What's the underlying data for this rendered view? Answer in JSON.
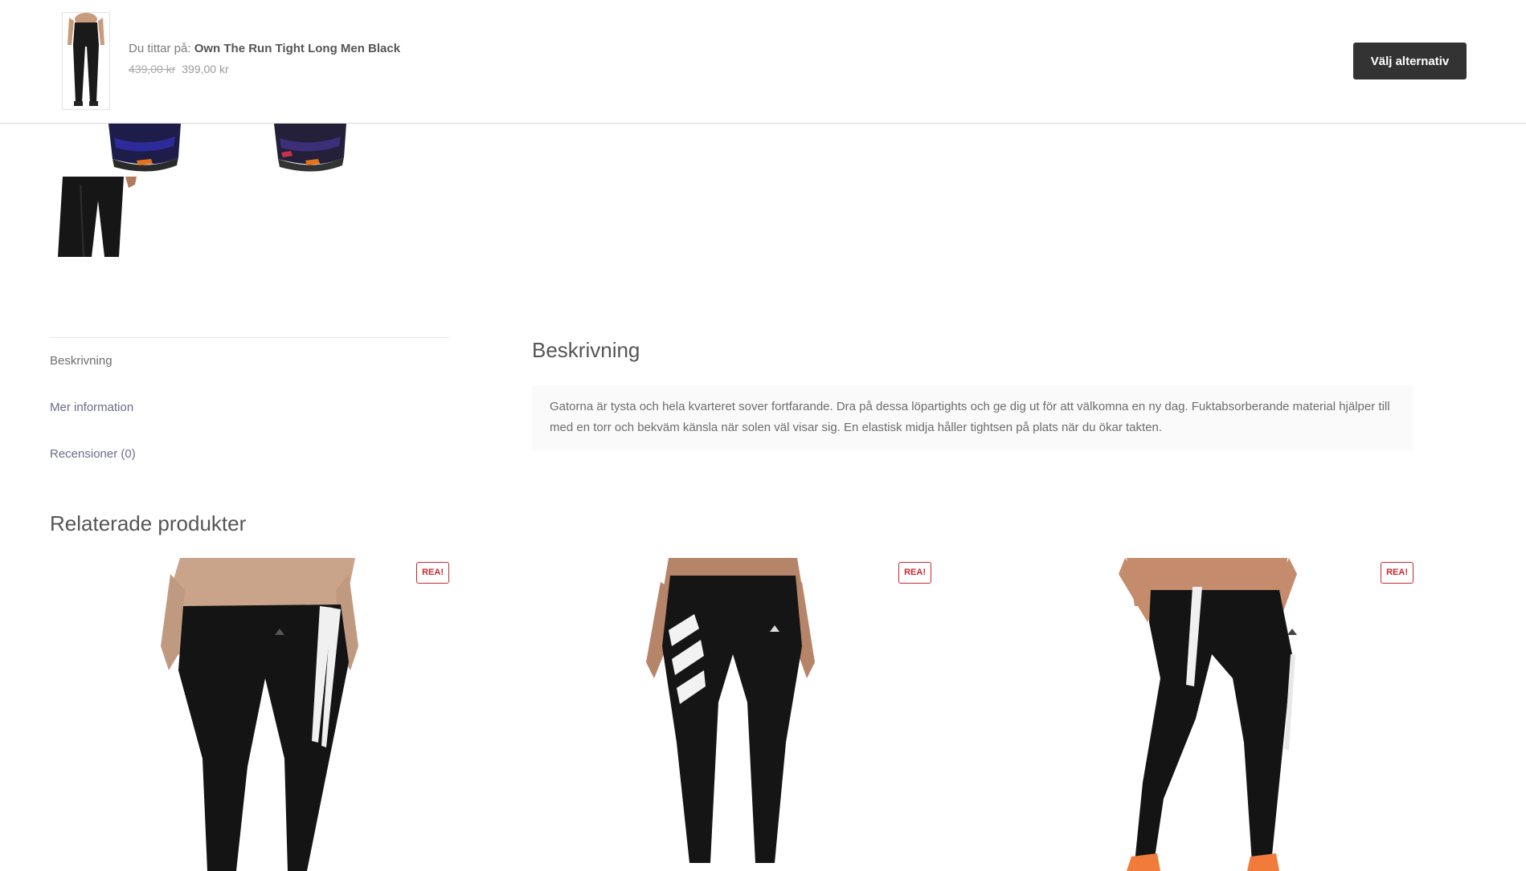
{
  "sticky": {
    "viewing_label": "Du tittar på: ",
    "product_name": "Own The Run Tight Long Men Black",
    "old_price": "439,00 kr",
    "new_price": "399,00 kr",
    "button_label": "Välj alternativ"
  },
  "tabs": [
    {
      "label": "Beskrivning",
      "active": true
    },
    {
      "label": "Mer information",
      "active": false
    },
    {
      "label": "Recensioner (0)",
      "active": false
    }
  ],
  "description": {
    "title": "Beskrivning",
    "text": "Gatorna är tysta och hela kvarteret sover fortfarande. Dra på dessa löpartights och ge dig ut för att välkomna en ny dag. Fuktabsorberande material hjälper till med en torr och bekväm känsla när solen väl visar sig. En elastisk midja håller tightsen på plats när du ökar takten."
  },
  "related": {
    "title": "Relaterade produkter",
    "products": [
      {
        "badge": "REA!"
      },
      {
        "badge": "REA!"
      },
      {
        "badge": "REA!"
      }
    ]
  },
  "colors": {
    "accent_button": "#333333",
    "sale_badge": "#c9282d",
    "link": "#6b6b8c"
  }
}
